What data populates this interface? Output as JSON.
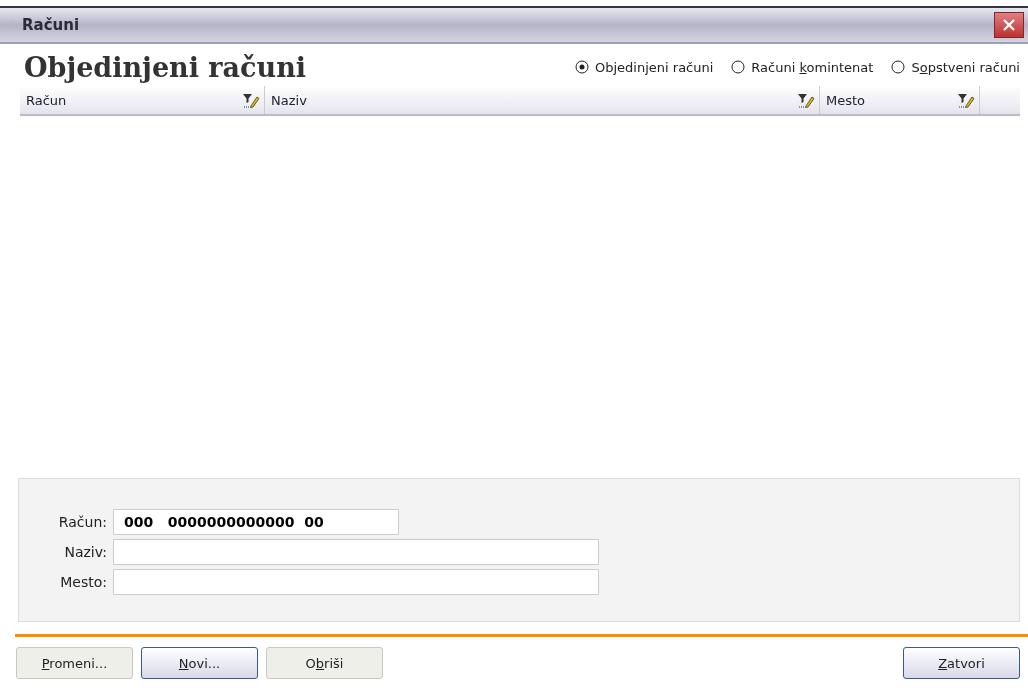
{
  "window": {
    "title": "Računi"
  },
  "heading": "Objedinjeni računi",
  "view_options": [
    {
      "pre": "Ob",
      "key": "j",
      "post": "edinjeni računi",
      "selected": true
    },
    {
      "pre": "Računi ",
      "key": "k",
      "post": "omintenat",
      "selected": false
    },
    {
      "pre": "S",
      "key": "o",
      "post": "pstveni računi",
      "selected": false
    }
  ],
  "table": {
    "columns": [
      {
        "label": "Račun"
      },
      {
        "label": "Naziv"
      },
      {
        "label": "Mesto"
      }
    ]
  },
  "form": {
    "fields": [
      {
        "label": "Račun:",
        "value": "000   0000000000000  00",
        "kind": "short"
      },
      {
        "label": "Naziv:",
        "kind": "long"
      },
      {
        "label": "Mesto:",
        "kind": "long"
      }
    ]
  },
  "left_buttons": [
    {
      "key": "P",
      "post": "romeni...",
      "default": false
    },
    {
      "key": "N",
      "post": "ovi...",
      "default": true
    },
    {
      "pre": "O",
      "key": "b",
      "post": "riši",
      "default": false
    }
  ],
  "right_buttons": [
    {
      "key": "Z",
      "post": "atvori",
      "default": true
    }
  ]
}
